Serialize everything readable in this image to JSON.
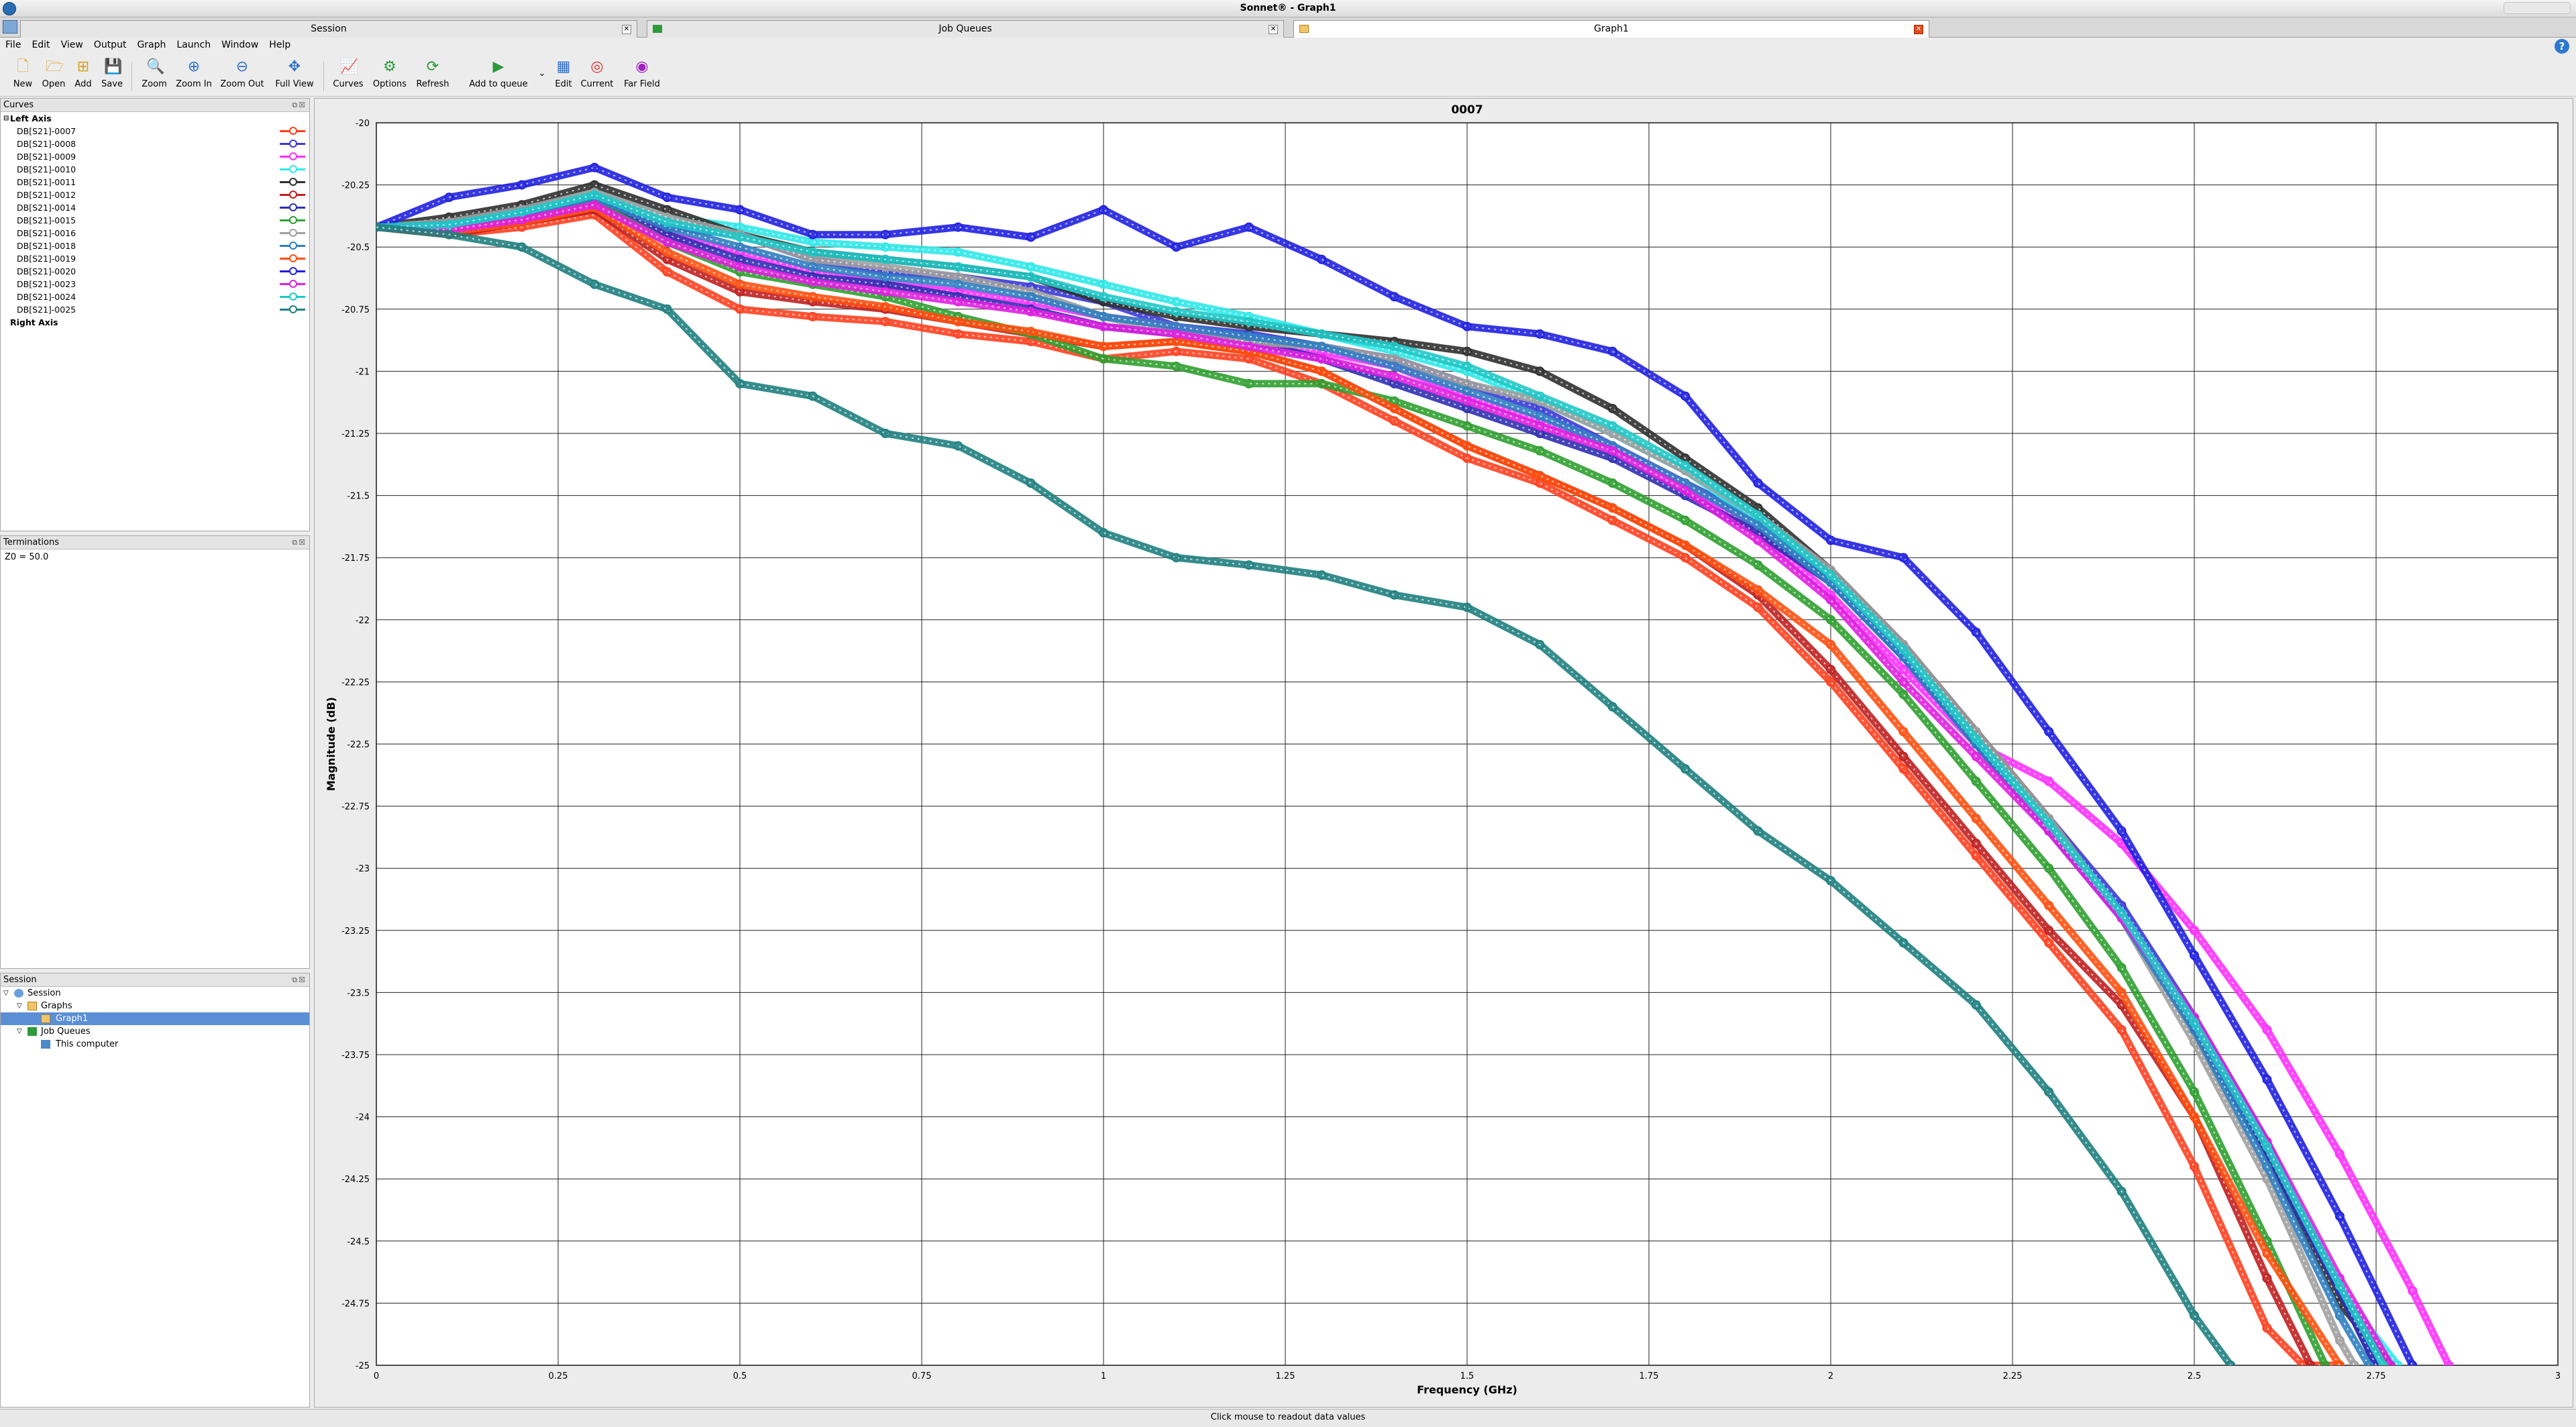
{
  "window": {
    "title": "Sonnet® - Graph1"
  },
  "tabs": [
    {
      "label": "Session"
    },
    {
      "label": "Job Queues"
    },
    {
      "label": "Graph1",
      "active": true
    }
  ],
  "menu": [
    "File",
    "Edit",
    "View",
    "Output",
    "Graph",
    "Launch",
    "Window",
    "Help"
  ],
  "toolbar": [
    {
      "label": "New",
      "icon": "new-icon"
    },
    {
      "label": "Open",
      "icon": "open-icon"
    },
    {
      "label": "Add",
      "icon": "add-icon"
    },
    {
      "label": "Save",
      "icon": "save-icon"
    },
    {
      "label": "Zoom",
      "icon": "zoom-icon"
    },
    {
      "label": "Zoom In",
      "icon": "zoom-in-icon"
    },
    {
      "label": "Zoom Out",
      "icon": "zoom-out-icon"
    },
    {
      "label": "Full View",
      "icon": "full-view-icon"
    },
    {
      "label": "Curves",
      "icon": "curves-icon"
    },
    {
      "label": "Options",
      "icon": "options-icon"
    },
    {
      "label": "Refresh",
      "icon": "refresh-icon"
    },
    {
      "label": "Add to queue",
      "icon": "add-to-queue-icon"
    },
    {
      "label": "Edit",
      "icon": "edit-icon"
    },
    {
      "label": "Current",
      "icon": "current-icon"
    },
    {
      "label": "Far Field",
      "icon": "far-field-icon"
    }
  ],
  "curves_panel": {
    "title": "Curves",
    "left_axis_label": "Left Axis",
    "right_axis_label": "Right Axis",
    "curves": [
      {
        "label": "DB[S21]-0007",
        "color": "#ff4020"
      },
      {
        "label": "DB[S21]-0008",
        "color": "#3a3ad8"
      },
      {
        "label": "DB[S21]-0009",
        "color": "#ff30ff"
      },
      {
        "label": "DB[S21]-0010",
        "color": "#30e8e8"
      },
      {
        "label": "DB[S21]-0011",
        "color": "#303030"
      },
      {
        "label": "DB[S21]-0012",
        "color": "#c02020"
      },
      {
        "label": "DB[S21]-0014",
        "color": "#3030b0"
      },
      {
        "label": "DB[S21]-0015",
        "color": "#30a030"
      },
      {
        "label": "DB[S21]-0016",
        "color": "#a0a0a0"
      },
      {
        "label": "DB[S21]-0018",
        "color": "#3080c0"
      },
      {
        "label": "DB[S21]-0019",
        "color": "#ff5010"
      },
      {
        "label": "DB[S21]-0020",
        "color": "#2020e0"
      },
      {
        "label": "DB[S21]-0023",
        "color": "#e020e0"
      },
      {
        "label": "DB[S21]-0024",
        "color": "#20c8c8"
      },
      {
        "label": "DB[S21]-0025",
        "color": "#208080"
      }
    ]
  },
  "terminations_panel": {
    "title": "Terminations",
    "text": "Z0 = 50.0"
  },
  "session_panel": {
    "title": "Session",
    "items": [
      {
        "label": "Session",
        "level": 0
      },
      {
        "label": "Graphs",
        "level": 1
      },
      {
        "label": "Graph1",
        "level": 2,
        "selected": true
      },
      {
        "label": "Job Queues",
        "level": 1
      },
      {
        "label": "This computer",
        "level": 2
      }
    ]
  },
  "status_text": "Click mouse to readout data values",
  "chart_data": {
    "type": "scatter",
    "title": "0007",
    "xlabel": "Frequency (GHz)",
    "ylabel": "Magnitude (dB)",
    "xlim": [
      0,
      3
    ],
    "ylim": [
      -25,
      -20
    ],
    "xticks": [
      "0",
      "0.25",
      "0.5",
      "0.75",
      "1",
      "1.25",
      "1.5",
      "1.75",
      "2",
      "2.25",
      "2.5",
      "2.75",
      "3"
    ],
    "yticks": [
      "-20",
      "-20.25",
      "-20.5",
      "-20.75",
      "-21",
      "-21.25",
      "-21.5",
      "-21.75",
      "-22",
      "-22.25",
      "-22.5",
      "-22.75",
      "-23",
      "-23.25",
      "-23.5",
      "-23.75",
      "-24",
      "-24.25",
      "-24.5",
      "-24.75",
      "-25"
    ],
    "grid": true,
    "series": [
      {
        "name": "DB[S21]-0007",
        "color": "#ff4020",
        "x": [
          0,
          0.1,
          0.2,
          0.3,
          0.4,
          0.5,
          0.6,
          0.7,
          0.8,
          0.9,
          1.0,
          1.1,
          1.2,
          1.3,
          1.4,
          1.5,
          1.6,
          1.7,
          1.8,
          1.9,
          2.0,
          2.1,
          2.2,
          2.3,
          2.4,
          2.5,
          2.6,
          2.65,
          2.7
        ],
        "y": [
          -20.42,
          -20.45,
          -20.42,
          -20.37,
          -20.6,
          -20.75,
          -20.78,
          -20.8,
          -20.85,
          -20.88,
          -20.95,
          -20.92,
          -20.95,
          -21.05,
          -21.2,
          -21.35,
          -21.45,
          -21.6,
          -21.75,
          -21.95,
          -22.25,
          -22.6,
          -22.95,
          -23.3,
          -23.65,
          -24.2,
          -24.85,
          -25.0,
          -25.0
        ]
      },
      {
        "name": "DB[S21]-0008",
        "color": "#3a3ad8",
        "x": [
          0,
          0.1,
          0.2,
          0.3,
          0.4,
          0.5,
          0.6,
          0.7,
          0.8,
          0.9,
          1.0,
          1.1,
          1.2,
          1.3,
          1.4,
          1.5,
          1.6,
          1.7,
          1.8,
          1.9,
          2.0,
          2.1,
          2.2,
          2.3,
          2.4,
          2.5,
          2.6,
          2.7,
          2.75
        ],
        "y": [
          -20.42,
          -20.4,
          -20.38,
          -20.3,
          -20.42,
          -20.45,
          -20.55,
          -20.6,
          -20.62,
          -20.66,
          -20.72,
          -20.82,
          -20.85,
          -20.9,
          -20.95,
          -21.05,
          -21.15,
          -21.3,
          -21.45,
          -21.6,
          -21.8,
          -22.1,
          -22.45,
          -22.8,
          -23.15,
          -23.6,
          -24.1,
          -24.7,
          -25.0
        ]
      },
      {
        "name": "DB[S21]-0009",
        "color": "#ff30ff",
        "x": [
          0,
          0.1,
          0.2,
          0.3,
          0.4,
          0.5,
          0.6,
          0.7,
          0.8,
          0.9,
          1.0,
          1.1,
          1.2,
          1.3,
          1.4,
          1.5,
          1.6,
          1.7,
          1.8,
          1.9,
          2.0,
          2.1,
          2.2,
          2.3,
          2.4,
          2.5,
          2.6,
          2.7,
          2.8,
          2.85
        ],
        "y": [
          -20.42,
          -20.43,
          -20.38,
          -20.32,
          -20.45,
          -20.52,
          -20.6,
          -20.65,
          -20.68,
          -20.72,
          -20.78,
          -20.82,
          -20.88,
          -20.92,
          -20.98,
          -21.1,
          -21.2,
          -21.3,
          -21.45,
          -21.65,
          -21.9,
          -22.2,
          -22.5,
          -22.65,
          -22.9,
          -23.25,
          -23.65,
          -24.15,
          -24.7,
          -25.0
        ]
      },
      {
        "name": "DB[S21]-0010",
        "color": "#30e8e8",
        "x": [
          0,
          0.1,
          0.2,
          0.3,
          0.4,
          0.5,
          0.6,
          0.7,
          0.8,
          0.9,
          1.0,
          1.1,
          1.2,
          1.3,
          1.4,
          1.5,
          1.6,
          1.7,
          1.8,
          1.9,
          2.0,
          2.1,
          2.2,
          2.3,
          2.4,
          2.5,
          2.6,
          2.7,
          2.78
        ],
        "y": [
          -20.42,
          -20.4,
          -20.35,
          -20.28,
          -20.38,
          -20.42,
          -20.48,
          -20.5,
          -20.52,
          -20.58,
          -20.65,
          -20.72,
          -20.78,
          -20.85,
          -20.92,
          -21.0,
          -21.12,
          -21.25,
          -21.4,
          -21.6,
          -21.85,
          -22.15,
          -22.5,
          -22.85,
          -23.2,
          -23.65,
          -24.15,
          -24.7,
          -25.0
        ]
      },
      {
        "name": "DB[S21]-0011",
        "color": "#303030",
        "x": [
          0,
          0.1,
          0.2,
          0.3,
          0.4,
          0.5,
          0.6,
          0.7,
          0.8,
          0.9,
          1.0,
          1.1,
          1.2,
          1.3,
          1.4,
          1.5,
          1.6,
          1.7,
          1.8,
          1.9,
          2.0,
          2.1,
          2.2,
          2.3,
          2.4,
          2.5,
          2.6,
          2.7,
          2.77
        ],
        "y": [
          -20.42,
          -20.38,
          -20.33,
          -20.25,
          -20.35,
          -20.45,
          -20.52,
          -20.55,
          -20.58,
          -20.62,
          -20.72,
          -20.78,
          -20.82,
          -20.85,
          -20.88,
          -20.92,
          -21.0,
          -21.15,
          -21.35,
          -21.55,
          -21.8,
          -22.1,
          -22.45,
          -22.8,
          -23.2,
          -23.65,
          -24.15,
          -24.75,
          -25.0
        ]
      },
      {
        "name": "DB[S21]-0012",
        "color": "#c02020",
        "x": [
          0,
          0.1,
          0.2,
          0.3,
          0.4,
          0.5,
          0.6,
          0.7,
          0.8,
          0.9,
          1.0,
          1.1,
          1.2,
          1.3,
          1.4,
          1.5,
          1.6,
          1.7,
          1.8,
          1.9,
          2.0,
          2.1,
          2.2,
          2.3,
          2.4,
          2.5,
          2.6,
          2.66
        ],
        "y": [
          -20.42,
          -20.45,
          -20.4,
          -20.35,
          -20.55,
          -20.68,
          -20.72,
          -20.75,
          -20.8,
          -20.85,
          -20.9,
          -20.88,
          -20.92,
          -21.0,
          -21.15,
          -21.3,
          -21.42,
          -21.55,
          -21.7,
          -21.9,
          -22.2,
          -22.55,
          -22.9,
          -23.25,
          -23.55,
          -24.0,
          -24.65,
          -25.0
        ]
      },
      {
        "name": "DB[S21]-0014",
        "color": "#3030b0",
        "x": [
          0,
          0.1,
          0.2,
          0.3,
          0.4,
          0.5,
          0.6,
          0.7,
          0.8,
          0.9,
          1.0,
          1.1,
          1.2,
          1.3,
          1.4,
          1.5,
          1.6,
          1.7,
          1.8,
          1.9,
          2.0,
          2.1,
          2.2,
          2.3,
          2.4,
          2.5,
          2.6,
          2.7,
          2.75
        ],
        "y": [
          -20.42,
          -20.42,
          -20.38,
          -20.3,
          -20.45,
          -20.55,
          -20.62,
          -20.65,
          -20.7,
          -20.75,
          -20.82,
          -20.85,
          -20.88,
          -20.95,
          -21.05,
          -21.15,
          -21.25,
          -21.35,
          -21.5,
          -21.65,
          -21.85,
          -22.15,
          -22.5,
          -22.85,
          -23.2,
          -23.65,
          -24.15,
          -24.7,
          -25.0
        ]
      },
      {
        "name": "DB[S21]-0015",
        "color": "#30a030",
        "x": [
          0,
          0.1,
          0.2,
          0.3,
          0.4,
          0.5,
          0.6,
          0.7,
          0.8,
          0.9,
          1.0,
          1.1,
          1.2,
          1.3,
          1.4,
          1.5,
          1.6,
          1.7,
          1.8,
          1.9,
          2.0,
          2.1,
          2.2,
          2.3,
          2.4,
          2.5,
          2.6,
          2.68
        ],
        "y": [
          -20.42,
          -20.43,
          -20.38,
          -20.32,
          -20.48,
          -20.6,
          -20.65,
          -20.7,
          -20.78,
          -20.85,
          -20.95,
          -20.98,
          -21.05,
          -21.05,
          -21.12,
          -21.22,
          -21.32,
          -21.45,
          -21.6,
          -21.78,
          -22.0,
          -22.3,
          -22.65,
          -23.0,
          -23.4,
          -23.9,
          -24.5,
          -25.0
        ]
      },
      {
        "name": "DB[S21]-0016",
        "color": "#a0a0a0",
        "x": [
          0,
          0.1,
          0.2,
          0.3,
          0.4,
          0.5,
          0.6,
          0.7,
          0.8,
          0.9,
          1.0,
          1.1,
          1.2,
          1.3,
          1.4,
          1.5,
          1.6,
          1.7,
          1.8,
          1.9,
          2.0,
          2.1,
          2.2,
          2.3,
          2.4,
          2.5,
          2.6,
          2.7,
          2.72
        ],
        "y": [
          -20.42,
          -20.4,
          -20.35,
          -20.28,
          -20.38,
          -20.45,
          -20.55,
          -20.58,
          -20.62,
          -20.68,
          -20.78,
          -20.85,
          -20.88,
          -20.9,
          -20.95,
          -21.05,
          -21.12,
          -21.25,
          -21.4,
          -21.58,
          -21.8,
          -22.1,
          -22.45,
          -22.8,
          -23.2,
          -23.7,
          -24.25,
          -24.9,
          -25.0
        ]
      },
      {
        "name": "DB[S21]-0018",
        "color": "#3080c0",
        "x": [
          0,
          0.1,
          0.2,
          0.3,
          0.4,
          0.5,
          0.6,
          0.7,
          0.8,
          0.9,
          1.0,
          1.1,
          1.2,
          1.3,
          1.4,
          1.5,
          1.6,
          1.7,
          1.8,
          1.9,
          2.0,
          2.1,
          2.2,
          2.3,
          2.4,
          2.5,
          2.6,
          2.7,
          2.74
        ],
        "y": [
          -20.42,
          -20.41,
          -20.37,
          -20.3,
          -20.42,
          -20.5,
          -20.58,
          -20.62,
          -20.65,
          -20.7,
          -20.78,
          -20.82,
          -20.86,
          -20.9,
          -20.98,
          -21.08,
          -21.18,
          -21.3,
          -21.45,
          -21.62,
          -21.85,
          -22.15,
          -22.5,
          -22.85,
          -23.2,
          -23.65,
          -24.2,
          -24.8,
          -25.0
        ]
      },
      {
        "name": "DB[S21]-0019",
        "color": "#ff5010",
        "x": [
          0,
          0.1,
          0.2,
          0.3,
          0.4,
          0.5,
          0.6,
          0.7,
          0.8,
          0.9,
          1.0,
          1.1,
          1.2,
          1.3,
          1.4,
          1.5,
          1.6,
          1.7,
          1.8,
          1.9,
          2.0,
          2.1,
          2.2,
          2.3,
          2.4,
          2.5,
          2.6,
          2.7
        ],
        "y": [
          -20.42,
          -20.44,
          -20.4,
          -20.34,
          -20.52,
          -20.65,
          -20.7,
          -20.74,
          -20.8,
          -20.84,
          -20.9,
          -20.88,
          -20.92,
          -21.0,
          -21.15,
          -21.3,
          -21.42,
          -21.55,
          -21.7,
          -21.88,
          -22.1,
          -22.45,
          -22.8,
          -23.15,
          -23.5,
          -24.0,
          -24.55,
          -25.0
        ]
      },
      {
        "name": "DB[S21]-0020",
        "color": "#2020e0",
        "x": [
          0,
          0.1,
          0.2,
          0.3,
          0.4,
          0.5,
          0.6,
          0.7,
          0.8,
          0.9,
          1.0,
          1.1,
          1.2,
          1.3,
          1.4,
          1.5,
          1.6,
          1.7,
          1.8,
          1.9,
          2.0,
          2.1,
          2.2,
          2.3,
          2.4,
          2.5,
          2.6,
          2.7,
          2.8
        ],
        "y": [
          -20.42,
          -20.3,
          -20.25,
          -20.18,
          -20.3,
          -20.35,
          -20.45,
          -20.45,
          -20.42,
          -20.46,
          -20.35,
          -20.5,
          -20.42,
          -20.55,
          -20.7,
          -20.82,
          -20.85,
          -20.92,
          -21.1,
          -21.45,
          -21.68,
          -21.75,
          -22.05,
          -22.45,
          -22.85,
          -23.35,
          -23.85,
          -24.4,
          -25.0
        ]
      },
      {
        "name": "DB[S21]-0023",
        "color": "#e020e0",
        "x": [
          0,
          0.1,
          0.2,
          0.3,
          0.4,
          0.5,
          0.6,
          0.7,
          0.8,
          0.9,
          1.0,
          1.1,
          1.2,
          1.3,
          1.4,
          1.5,
          1.6,
          1.7,
          1.8,
          1.9,
          2.0,
          2.1,
          2.2,
          2.3,
          2.4,
          2.5,
          2.6,
          2.7,
          2.77
        ],
        "y": [
          -20.42,
          -20.43,
          -20.39,
          -20.33,
          -20.48,
          -20.58,
          -20.64,
          -20.68,
          -20.72,
          -20.76,
          -20.82,
          -20.85,
          -20.9,
          -20.95,
          -21.02,
          -21.12,
          -21.22,
          -21.32,
          -21.48,
          -21.68,
          -21.92,
          -22.25,
          -22.55,
          -22.85,
          -23.2,
          -23.6,
          -24.1,
          -24.65,
          -25.0
        ]
      },
      {
        "name": "DB[S21]-0024",
        "color": "#20c8c8",
        "x": [
          0,
          0.1,
          0.2,
          0.3,
          0.4,
          0.5,
          0.6,
          0.7,
          0.8,
          0.9,
          1.0,
          1.1,
          1.2,
          1.3,
          1.4,
          1.5,
          1.6,
          1.7,
          1.8,
          1.9,
          2.0,
          2.1,
          2.2,
          2.3,
          2.4,
          2.5,
          2.6,
          2.7,
          2.76
        ],
        "y": [
          -20.42,
          -20.41,
          -20.36,
          -20.29,
          -20.4,
          -20.46,
          -20.52,
          -20.55,
          -20.58,
          -20.62,
          -20.7,
          -20.76,
          -20.8,
          -20.85,
          -20.9,
          -20.98,
          -21.1,
          -21.22,
          -21.38,
          -21.58,
          -21.82,
          -22.12,
          -22.48,
          -22.82,
          -23.18,
          -23.62,
          -24.12,
          -24.68,
          -25.0
        ]
      },
      {
        "name": "DB[S21]-0025",
        "color": "#208080",
        "x": [
          0,
          0.1,
          0.2,
          0.3,
          0.4,
          0.5,
          0.6,
          0.7,
          0.8,
          0.9,
          1.0,
          1.1,
          1.2,
          1.3,
          1.4,
          1.5,
          1.6,
          1.7,
          1.8,
          1.9,
          2.0,
          2.1,
          2.2,
          2.3,
          2.4,
          2.5,
          2.55
        ],
        "y": [
          -20.42,
          -20.45,
          -20.5,
          -20.65,
          -20.75,
          -21.05,
          -21.1,
          -21.25,
          -21.3,
          -21.45,
          -21.65,
          -21.75,
          -21.78,
          -21.82,
          -21.9,
          -21.95,
          -22.1,
          -22.35,
          -22.6,
          -22.85,
          -23.05,
          -23.3,
          -23.55,
          -23.9,
          -24.3,
          -24.8,
          -25.0
        ]
      }
    ]
  }
}
